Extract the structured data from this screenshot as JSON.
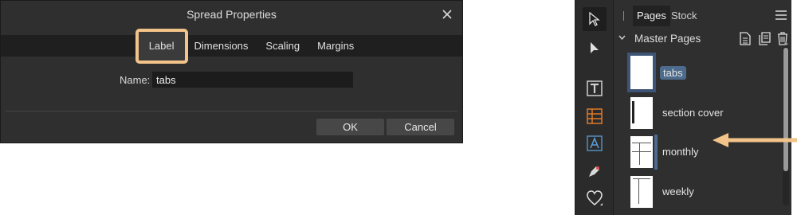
{
  "dialog": {
    "title": "Spread Properties",
    "tabs": [
      "Label",
      "Dimensions",
      "Scaling",
      "Margins"
    ],
    "active_tab": "Label",
    "name_label": "Name:",
    "name_value": "tabs",
    "ok_label": "OK",
    "cancel_label": "Cancel",
    "highlight_color": "#f3c48a"
  },
  "panel": {
    "tabs": [
      "Pages",
      "Stock"
    ],
    "active_tab": "Pages",
    "section_title": "Master Pages",
    "section_icons": [
      "insert-page-icon",
      "duplicate-page-icon",
      "delete-page-icon"
    ],
    "items": [
      {
        "label": "tabs",
        "thumb": "blank",
        "selected": true
      },
      {
        "label": "section cover",
        "thumb": "left-bar"
      },
      {
        "label": "monthly",
        "thumb": "grid"
      },
      {
        "label": "weekly",
        "thumb": "columns"
      }
    ],
    "selection_color": "#4d6b8c",
    "annotation_arrow_color": "#f3c48a"
  },
  "toolbar": {
    "tools": [
      "move-tool-icon",
      "node-tool-icon",
      "frame-text-tool-icon",
      "table-tool-icon",
      "artistic-text-tool-icon",
      "pen-tool-icon",
      "shape-tool-icon"
    ]
  }
}
